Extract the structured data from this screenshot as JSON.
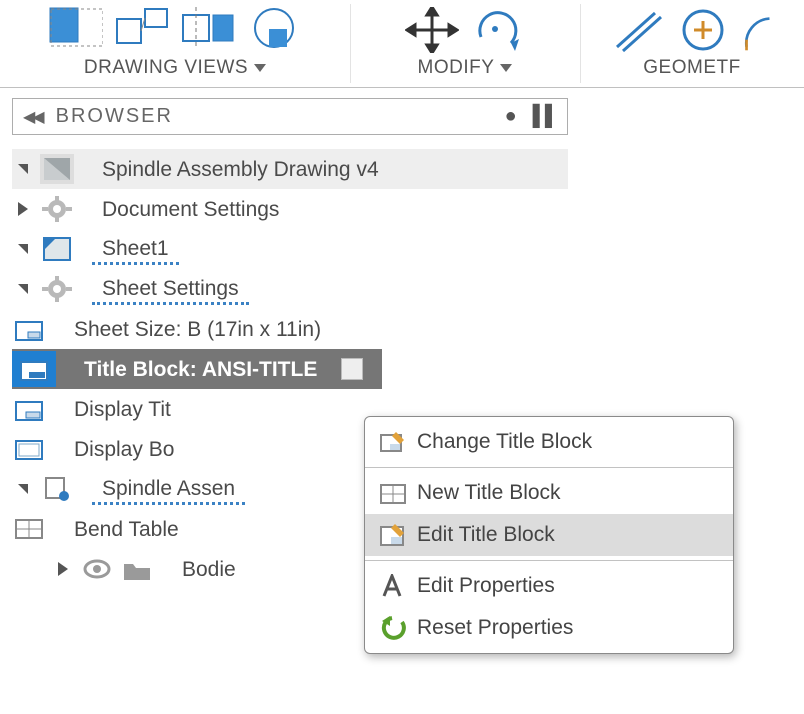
{
  "ribbon": {
    "drawing_views_label": "DRAWING VIEWS",
    "modify_label": "MODIFY",
    "geometry_label": "GEOMETF"
  },
  "browser": {
    "title": "BROWSER"
  },
  "tree": {
    "root": "Spindle Assembly Drawing v4",
    "doc_settings": "Document Settings",
    "sheet1": "Sheet1",
    "sheet_settings": "Sheet Settings",
    "sheet_size": "Sheet Size: B (17in x 11in)",
    "title_block": "Title Block: ANSI-TITLE",
    "display_title": "Display Tit",
    "display_border": "Display Bo",
    "spindle_assembly": "Spindle Assen",
    "bend_table": "Bend Table",
    "bodies": "Bodie"
  },
  "context_menu": {
    "change": "Change Title Block",
    "new": "New Title Block",
    "edit": "Edit Title Block",
    "edit_props": "Edit Properties",
    "reset_props": "Reset Properties"
  }
}
